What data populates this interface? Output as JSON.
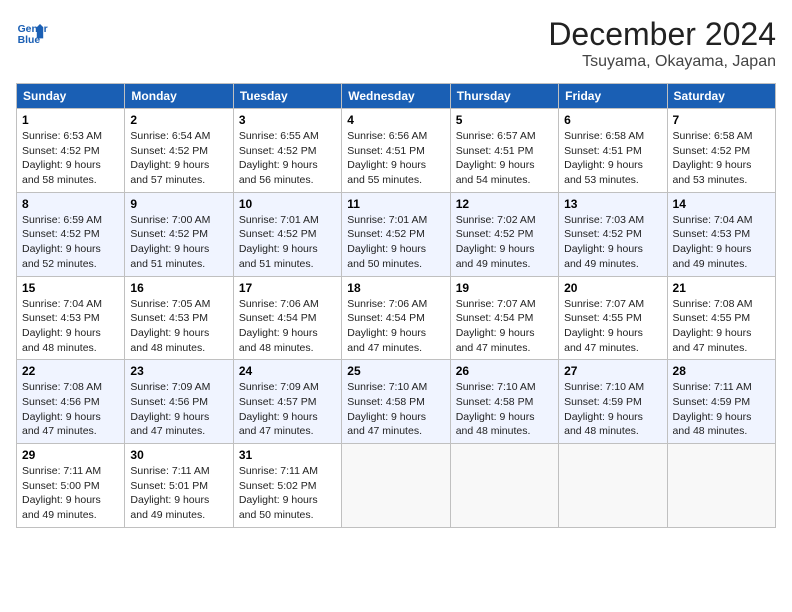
{
  "logo": {
    "line1": "General",
    "line2": "Blue"
  },
  "title": "December 2024",
  "subtitle": "Tsuyama, Okayama, Japan",
  "days_of_week": [
    "Sunday",
    "Monday",
    "Tuesday",
    "Wednesday",
    "Thursday",
    "Friday",
    "Saturday"
  ],
  "weeks": [
    [
      {
        "day": "1",
        "sunrise": "6:53 AM",
        "sunset": "4:52 PM",
        "daylight": "9 hours and 58 minutes."
      },
      {
        "day": "2",
        "sunrise": "6:54 AM",
        "sunset": "4:52 PM",
        "daylight": "9 hours and 57 minutes."
      },
      {
        "day": "3",
        "sunrise": "6:55 AM",
        "sunset": "4:52 PM",
        "daylight": "9 hours and 56 minutes."
      },
      {
        "day": "4",
        "sunrise": "6:56 AM",
        "sunset": "4:51 PM",
        "daylight": "9 hours and 55 minutes."
      },
      {
        "day": "5",
        "sunrise": "6:57 AM",
        "sunset": "4:51 PM",
        "daylight": "9 hours and 54 minutes."
      },
      {
        "day": "6",
        "sunrise": "6:58 AM",
        "sunset": "4:51 PM",
        "daylight": "9 hours and 53 minutes."
      },
      {
        "day": "7",
        "sunrise": "6:58 AM",
        "sunset": "4:52 PM",
        "daylight": "9 hours and 53 minutes."
      }
    ],
    [
      {
        "day": "8",
        "sunrise": "6:59 AM",
        "sunset": "4:52 PM",
        "daylight": "9 hours and 52 minutes."
      },
      {
        "day": "9",
        "sunrise": "7:00 AM",
        "sunset": "4:52 PM",
        "daylight": "9 hours and 51 minutes."
      },
      {
        "day": "10",
        "sunrise": "7:01 AM",
        "sunset": "4:52 PM",
        "daylight": "9 hours and 51 minutes."
      },
      {
        "day": "11",
        "sunrise": "7:01 AM",
        "sunset": "4:52 PM",
        "daylight": "9 hours and 50 minutes."
      },
      {
        "day": "12",
        "sunrise": "7:02 AM",
        "sunset": "4:52 PM",
        "daylight": "9 hours and 49 minutes."
      },
      {
        "day": "13",
        "sunrise": "7:03 AM",
        "sunset": "4:52 PM",
        "daylight": "9 hours and 49 minutes."
      },
      {
        "day": "14",
        "sunrise": "7:04 AM",
        "sunset": "4:53 PM",
        "daylight": "9 hours and 49 minutes."
      }
    ],
    [
      {
        "day": "15",
        "sunrise": "7:04 AM",
        "sunset": "4:53 PM",
        "daylight": "9 hours and 48 minutes."
      },
      {
        "day": "16",
        "sunrise": "7:05 AM",
        "sunset": "4:53 PM",
        "daylight": "9 hours and 48 minutes."
      },
      {
        "day": "17",
        "sunrise": "7:06 AM",
        "sunset": "4:54 PM",
        "daylight": "9 hours and 48 minutes."
      },
      {
        "day": "18",
        "sunrise": "7:06 AM",
        "sunset": "4:54 PM",
        "daylight": "9 hours and 47 minutes."
      },
      {
        "day": "19",
        "sunrise": "7:07 AM",
        "sunset": "4:54 PM",
        "daylight": "9 hours and 47 minutes."
      },
      {
        "day": "20",
        "sunrise": "7:07 AM",
        "sunset": "4:55 PM",
        "daylight": "9 hours and 47 minutes."
      },
      {
        "day": "21",
        "sunrise": "7:08 AM",
        "sunset": "4:55 PM",
        "daylight": "9 hours and 47 minutes."
      }
    ],
    [
      {
        "day": "22",
        "sunrise": "7:08 AM",
        "sunset": "4:56 PM",
        "daylight": "9 hours and 47 minutes."
      },
      {
        "day": "23",
        "sunrise": "7:09 AM",
        "sunset": "4:56 PM",
        "daylight": "9 hours and 47 minutes."
      },
      {
        "day": "24",
        "sunrise": "7:09 AM",
        "sunset": "4:57 PM",
        "daylight": "9 hours and 47 minutes."
      },
      {
        "day": "25",
        "sunrise": "7:10 AM",
        "sunset": "4:58 PM",
        "daylight": "9 hours and 47 minutes."
      },
      {
        "day": "26",
        "sunrise": "7:10 AM",
        "sunset": "4:58 PM",
        "daylight": "9 hours and 48 minutes."
      },
      {
        "day": "27",
        "sunrise": "7:10 AM",
        "sunset": "4:59 PM",
        "daylight": "9 hours and 48 minutes."
      },
      {
        "day": "28",
        "sunrise": "7:11 AM",
        "sunset": "4:59 PM",
        "daylight": "9 hours and 48 minutes."
      }
    ],
    [
      {
        "day": "29",
        "sunrise": "7:11 AM",
        "sunset": "5:00 PM",
        "daylight": "9 hours and 49 minutes."
      },
      {
        "day": "30",
        "sunrise": "7:11 AM",
        "sunset": "5:01 PM",
        "daylight": "9 hours and 49 minutes."
      },
      {
        "day": "31",
        "sunrise": "7:11 AM",
        "sunset": "5:02 PM",
        "daylight": "9 hours and 50 minutes."
      },
      null,
      null,
      null,
      null
    ]
  ]
}
